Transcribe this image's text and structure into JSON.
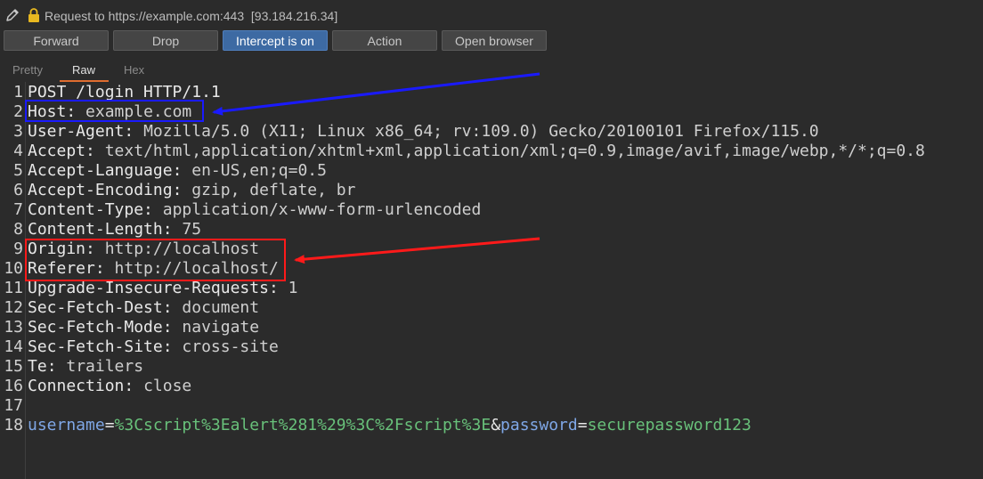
{
  "header": {
    "request_title": "Request to https://example.com:443",
    "ip": "[93.184.216.34]"
  },
  "toolbar": {
    "forward_label": "Forward",
    "drop_label": "Drop",
    "intercept_label": "Intercept is on",
    "action_label": "Action",
    "open_browser_label": "Open browser"
  },
  "tabs": {
    "pretty": "Pretty",
    "raw": "Raw",
    "hex": "Hex",
    "selected": "Raw"
  },
  "request": {
    "lines": [
      {
        "n": "1",
        "text": "POST /login HTTP/1.1"
      },
      {
        "n": "2",
        "name": "Host",
        "value": "example.com"
      },
      {
        "n": "3",
        "name": "User-Agent",
        "value": "Mozilla/5.0 (X11; Linux x86_64; rv:109.0) Gecko/20100101 Firefox/115.0"
      },
      {
        "n": "4",
        "name": "Accept",
        "value": "text/html,application/xhtml+xml,application/xml;q=0.9,image/avif,image/webp,*/*;q=0.8"
      },
      {
        "n": "5",
        "name": "Accept-Language",
        "value": "en-US,en;q=0.5"
      },
      {
        "n": "6",
        "name": "Accept-Encoding",
        "value": "gzip, deflate, br"
      },
      {
        "n": "7",
        "name": "Content-Type",
        "value": "application/x-www-form-urlencoded"
      },
      {
        "n": "8",
        "name": "Content-Length",
        "value": "75"
      },
      {
        "n": "9",
        "name": "Origin",
        "value": "http://localhost"
      },
      {
        "n": "10",
        "name": "Referer",
        "value": "http://localhost/"
      },
      {
        "n": "11",
        "name": "Upgrade-Insecure-Requests",
        "value": "1"
      },
      {
        "n": "12",
        "name": "Sec-Fetch-Dest",
        "value": "document"
      },
      {
        "n": "13",
        "name": "Sec-Fetch-Mode",
        "value": "navigate"
      },
      {
        "n": "14",
        "name": "Sec-Fetch-Site",
        "value": "cross-site"
      },
      {
        "n": "15",
        "name": "Te",
        "value": "trailers"
      },
      {
        "n": "16",
        "name": "Connection",
        "value": "close"
      },
      {
        "n": "17",
        "text": ""
      },
      {
        "n": "18",
        "body": [
          {
            "k": "username",
            "v": "%3Cscript%3Ealert%281%29%3C%2Fscript%3E"
          },
          {
            "k": "password",
            "v": "securepassword123"
          }
        ]
      }
    ]
  },
  "annotations": {
    "highlight_blue": "#1a1aff",
    "highlight_red": "#ff1a1a"
  },
  "icons": {
    "edit": "pencil-icon",
    "secure": "lock-icon"
  },
  "colors": {
    "accent_tab": "#e06d2f",
    "intercept_button": "#3d6aa3"
  }
}
